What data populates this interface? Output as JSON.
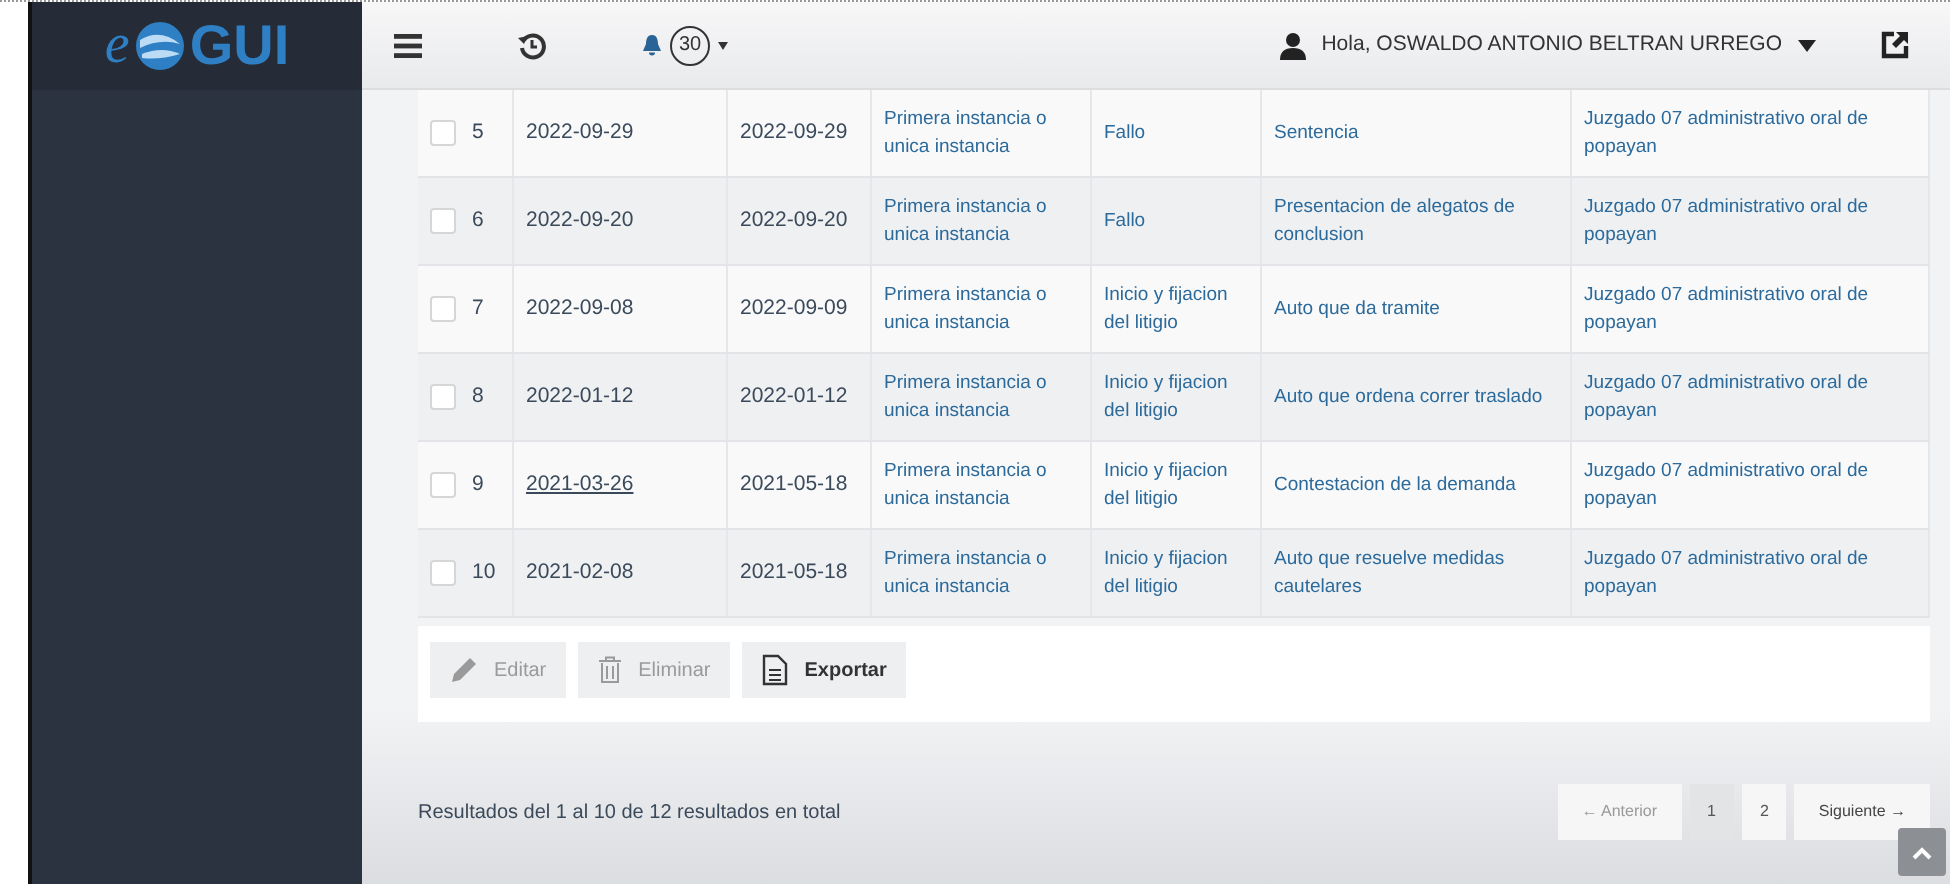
{
  "logo": {
    "prefix": "e",
    "name": "GUI"
  },
  "header": {
    "notifications": "30",
    "greeting": "Hola, OSWALDO ANTONIO BELTRAN URREGO"
  },
  "rows": [
    {
      "number": "5",
      "date_1": "2022-09-29",
      "date_1_link": false,
      "date_2": "2022-09-29",
      "instance": "Primera instancia o unica instancia",
      "stage": "Fallo",
      "action": "Sentencia",
      "court": "Juzgado 07 administrativo oral de popayan",
      "checked": false
    },
    {
      "number": "6",
      "date_1": "2022-09-20",
      "date_1_link": false,
      "date_2": "2022-09-20",
      "instance": "Primera instancia o unica instancia",
      "stage": "Fallo",
      "action": "Presentacion de alegatos de conclusion",
      "court": "Juzgado 07 administrativo oral de popayan",
      "checked": false
    },
    {
      "number": "7",
      "date_1": "2022-09-08",
      "date_1_link": false,
      "date_2": "2022-09-09",
      "instance": "Primera instancia o unica instancia",
      "stage": "Inicio y fijacion del litigio",
      "action": "Auto que da tramite",
      "court": "Juzgado 07 administrativo oral de popayan",
      "checked": false
    },
    {
      "number": "8",
      "date_1": "2022-01-12",
      "date_1_link": false,
      "date_2": "2022-01-12",
      "instance": "Primera instancia o unica instancia",
      "stage": "Inicio y fijacion del litigio",
      "action": "Auto que ordena correr traslado",
      "court": "Juzgado 07 administrativo oral de popayan",
      "checked": false
    },
    {
      "number": "9",
      "date_1": "2021-03-26",
      "date_1_link": true,
      "date_2": "2021-05-18",
      "instance": "Primera instancia o unica instancia",
      "stage": "Inicio y fijacion del litigio",
      "action": "Contestacion de la demanda",
      "court": "Juzgado 07 administrativo oral de popayan",
      "checked": false
    },
    {
      "number": "10",
      "date_1": "2021-02-08",
      "date_1_link": false,
      "date_2": "2021-05-18",
      "instance": "Primera instancia o unica instancia",
      "stage": "Inicio y fijacion del litigio",
      "action": "Auto que resuelve medidas cautelares",
      "court": "Juzgado 07 administrativo oral de popayan",
      "checked": false
    }
  ],
  "actions": [
    {
      "kind": "edit",
      "label": "Editar",
      "disabled": true
    },
    {
      "kind": "delete",
      "label": "Eliminar",
      "disabled": true
    },
    {
      "kind": "export",
      "label": "Exportar",
      "disabled": false
    }
  ],
  "summary": "Resultados del 1 al 10 de 12 resultados en total",
  "pagination": [
    {
      "kind": "prev",
      "label": "← Anterior",
      "selected": false
    },
    {
      "kind": "page",
      "label": "1",
      "selected": true
    },
    {
      "kind": "page",
      "label": "2",
      "selected": false
    },
    {
      "kind": "next",
      "label": "Siguiente →",
      "selected": false
    }
  ]
}
